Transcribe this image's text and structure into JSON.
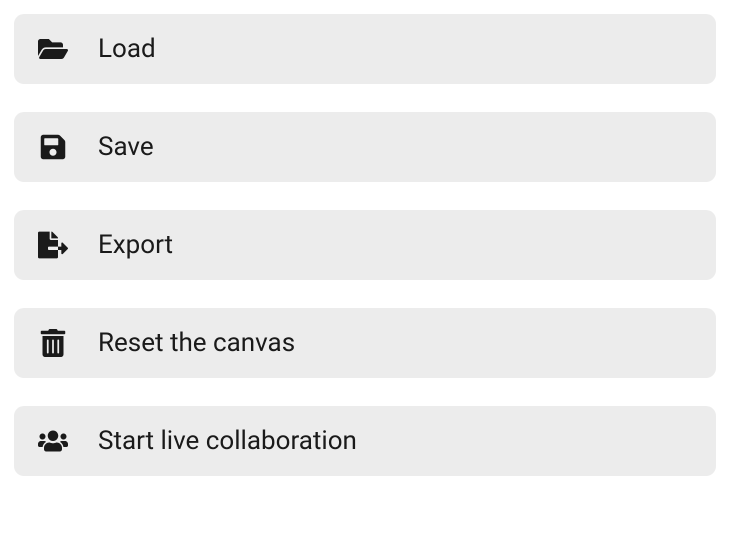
{
  "menu": {
    "items": [
      {
        "id": "load",
        "label": "Load",
        "icon": "folder-open-icon"
      },
      {
        "id": "save",
        "label": "Save",
        "icon": "save-icon"
      },
      {
        "id": "export",
        "label": "Export",
        "icon": "export-icon"
      },
      {
        "id": "reset",
        "label": "Reset the canvas",
        "icon": "trash-icon"
      },
      {
        "id": "collab",
        "label": "Start live collaboration",
        "icon": "users-icon"
      }
    ]
  }
}
